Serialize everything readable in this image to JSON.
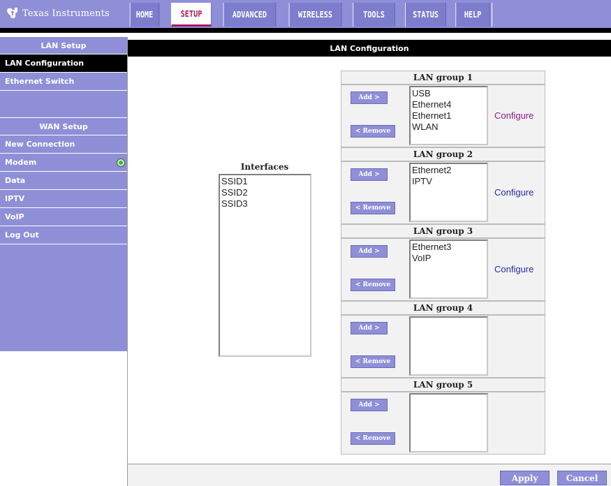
{
  "brand": {
    "name": "Texas Instruments"
  },
  "colors": {
    "accent": "#8f8fd8",
    "active_tab": "#b0185c",
    "link_visited": "#8b1a89",
    "link": "#2a2aa8"
  },
  "nav": {
    "tabs": [
      {
        "label": "HOME"
      },
      {
        "label": "SETUP"
      },
      {
        "label": "ADVANCED"
      },
      {
        "label": "WIRELESS"
      },
      {
        "label": "TOOLS"
      },
      {
        "label": "STATUS"
      },
      {
        "label": "HELP"
      }
    ],
    "active": "SETUP"
  },
  "sidebar": {
    "lan_header": "LAN Setup",
    "lan_items": [
      {
        "label": "LAN Configuration"
      },
      {
        "label": "Ethernet Switch"
      }
    ],
    "wan_header": "WAN Setup",
    "wan_items": [
      {
        "label": "New Connection"
      },
      {
        "label": "Modem",
        "status_icon": "green-led"
      },
      {
        "label": "Data"
      },
      {
        "label": "IPTV"
      },
      {
        "label": "VoIP"
      },
      {
        "label": "Log Out"
      }
    ]
  },
  "content": {
    "title": "LAN Configuration",
    "interfaces": {
      "label": "Interfaces",
      "items": [
        "SSID1",
        "SSID2",
        "SSID3"
      ]
    },
    "add_label": "Add >",
    "remove_label": "< Remove",
    "configure_label": "Configure",
    "groups": [
      {
        "title": "LAN group 1",
        "items": [
          "USB",
          "Ethernet4",
          "Ethernet1",
          "WLAN"
        ],
        "configure": true
      },
      {
        "title": "LAN group 2",
        "items": [
          "Ethernet2",
          "IPTV"
        ],
        "configure": true
      },
      {
        "title": "LAN group 3",
        "items": [
          "Ethernet3",
          "VoIP"
        ],
        "configure": true
      },
      {
        "title": "LAN group 4",
        "items": [],
        "configure": false
      },
      {
        "title": "LAN group 5",
        "items": [],
        "configure": false
      }
    ]
  },
  "footer": {
    "apply_label": "Apply",
    "cancel_label": "Cancel"
  }
}
